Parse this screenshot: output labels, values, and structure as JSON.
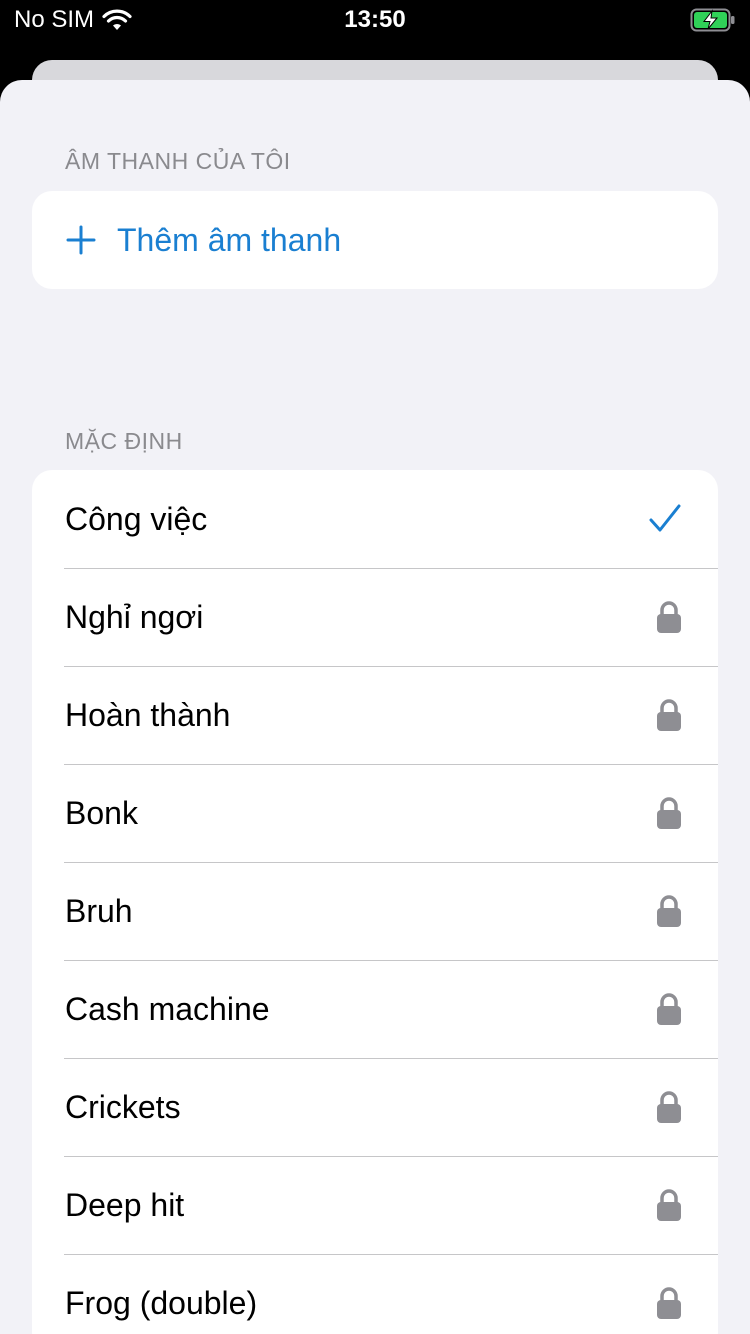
{
  "status_bar": {
    "carrier": "No SIM",
    "time": "13:50",
    "battery_color": "#30d158"
  },
  "my_sounds": {
    "header": "ÂM THANH CỦA TÔI",
    "add_label": "Thêm âm thanh"
  },
  "defaults": {
    "header": "MẶC ĐỊNH",
    "items": [
      {
        "label": "Công việc",
        "accessory": "checkmark-icon",
        "selected": true
      },
      {
        "label": "Nghỉ ngơi",
        "accessory": "lock-icon",
        "selected": false
      },
      {
        "label": "Hoàn thành",
        "accessory": "lock-icon",
        "selected": false
      },
      {
        "label": "Bonk",
        "accessory": "lock-icon",
        "selected": false
      },
      {
        "label": "Bruh",
        "accessory": "lock-icon",
        "selected": false
      },
      {
        "label": "Cash machine",
        "accessory": "lock-icon",
        "selected": false
      },
      {
        "label": "Crickets",
        "accessory": "lock-icon",
        "selected": false
      },
      {
        "label": "Deep hit",
        "accessory": "lock-icon",
        "selected": false
      },
      {
        "label": "Frog (double)",
        "accessory": "lock-icon",
        "selected": false
      }
    ]
  },
  "colors": {
    "accent": "#1a7fd1",
    "lock": "#8e8e93",
    "background": "#f2f2f7"
  }
}
